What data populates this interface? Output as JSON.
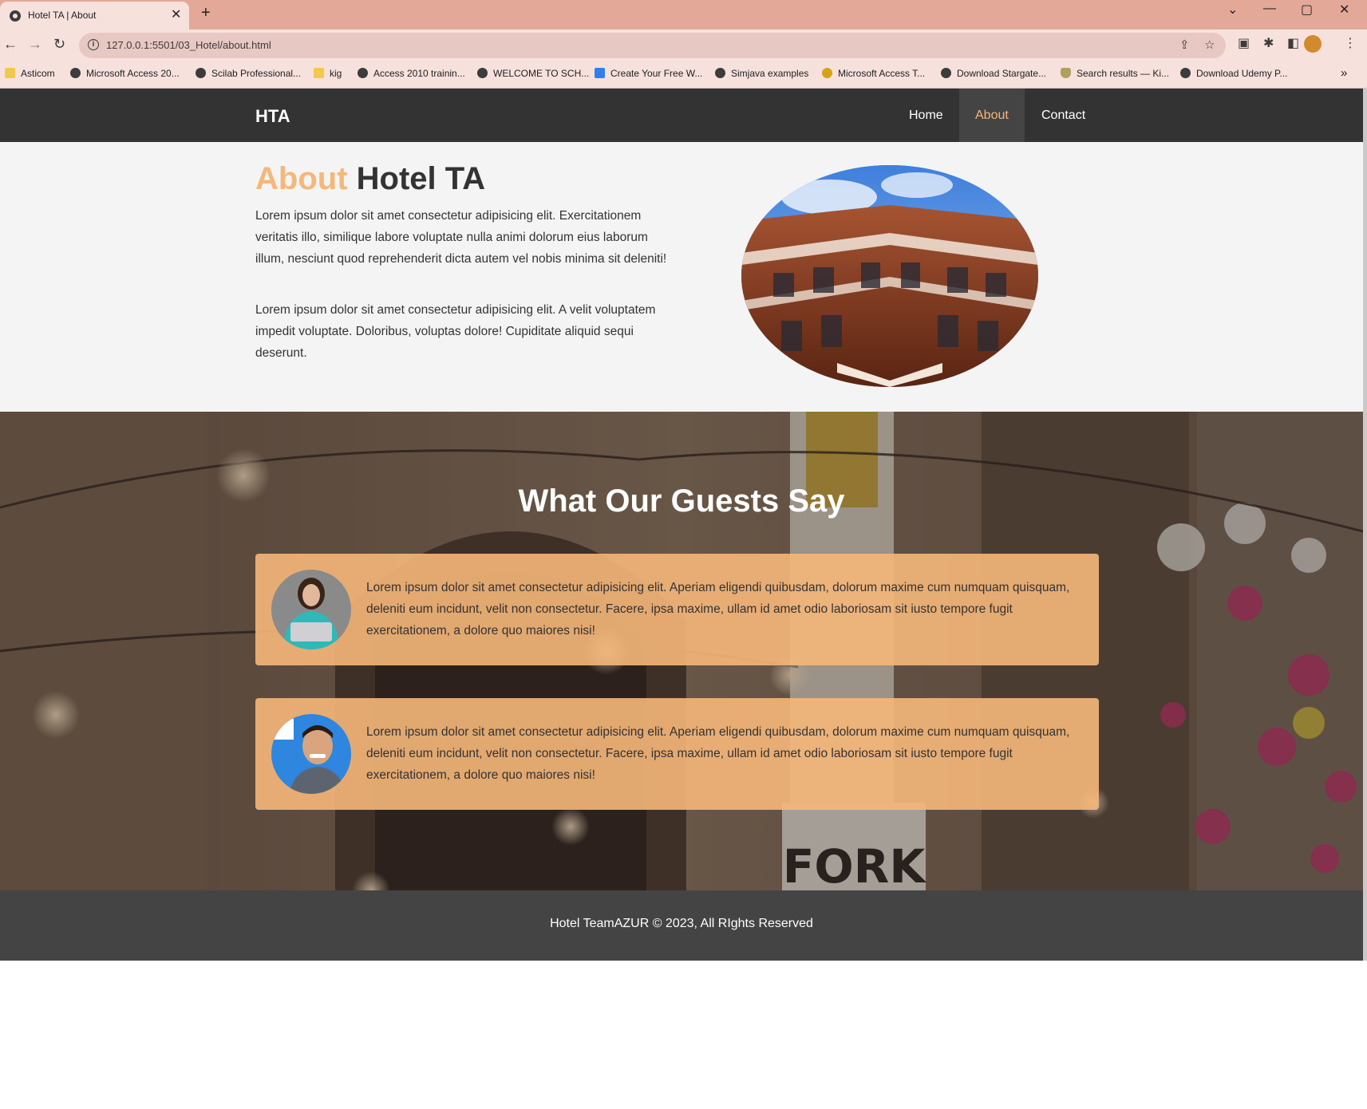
{
  "browser": {
    "tab_title": "Hotel TA | About",
    "tab_close": "✕",
    "new_tab": "+",
    "url": "127.0.0.1:5501/03_Hotel/about.html",
    "window_controls": {
      "dropdown": "⌄",
      "minimize": "—",
      "maximize": "▢",
      "close": "✕"
    },
    "nav": {
      "back": "←",
      "forward": "→",
      "reload": "↻",
      "info": "i",
      "share": "⇪",
      "star": "☆",
      "image": "▣",
      "puzzle": "✱",
      "sidebar": "◧",
      "menu": "⋮"
    },
    "bookmarks": [
      {
        "label": "Asticom",
        "icon": "folder"
      },
      {
        "label": "Microsoft Access 20...",
        "icon": "globe"
      },
      {
        "label": "Scilab Professional...",
        "icon": "scilab"
      },
      {
        "label": "kig",
        "icon": "folder"
      },
      {
        "label": "Access 2010 trainin...",
        "icon": "globe"
      },
      {
        "label": "WELCOME TO SCH...",
        "icon": "globe"
      },
      {
        "label": "Create Your Free W...",
        "icon": "blue"
      },
      {
        "label": "Simjava examples",
        "icon": "globe"
      },
      {
        "label": "Microsoft Access T...",
        "icon": "gold"
      },
      {
        "label": "Download Stargate...",
        "icon": "globe"
      },
      {
        "label": "Search results — Ki...",
        "icon": "shield"
      },
      {
        "label": "Download Udemy P...",
        "icon": "globe"
      }
    ],
    "bookmarks_more": "»"
  },
  "site": {
    "logo": "HTA",
    "nav": [
      {
        "label": "Home",
        "active": false
      },
      {
        "label": "About",
        "active": true
      },
      {
        "label": "Contact",
        "active": false
      }
    ],
    "accent_color": "#f5b77a",
    "about": {
      "title_accent": "About",
      "title_rest": "Hotel TA",
      "paragraph1": "Lorem ipsum dolor sit amet consectetur adipisicing elit. Exercitationem veritatis illo, similique labore voluptate nulla animi dolorum eius laborum illum, nesciunt quod reprehenderit dicta autem vel nobis minima sit deleniti!",
      "paragraph2": "Lorem ipsum dolor sit amet consectetur adipisicing elit. A velit voluptatem impedit voluptate. Doloribus, voluptas dolore! Cupiditate aliquid sequi deserunt."
    },
    "guests": {
      "title": "What Our Guests Say",
      "testimonials": [
        {
          "text": "Lorem ipsum dolor sit amet consectetur adipisicing elit. Aperiam eligendi quibusdam, dolorum maxime cum numquam quisquam, deleniti eum incidunt, velit non consectetur. Facere, ipsa maxime, ullam id amet odio laboriosam sit iusto tempore fugit exercitationem, a dolore quo maiores nisi!"
        },
        {
          "text": "Lorem ipsum dolor sit amet consectetur adipisicing elit. Aperiam eligendi quibusdam, dolorum maxime cum numquam quisquam, deleniti eum incidunt, velit non consectetur. Facere, ipsa maxime, ullam id amet odio laboriosam sit iusto tempore fugit exercitationem, a dolore quo maiores nisi!"
        }
      ],
      "sign_text": "FORK"
    },
    "footer": "Hotel TeamAZUR © 2023, All RIghts Reserved"
  }
}
